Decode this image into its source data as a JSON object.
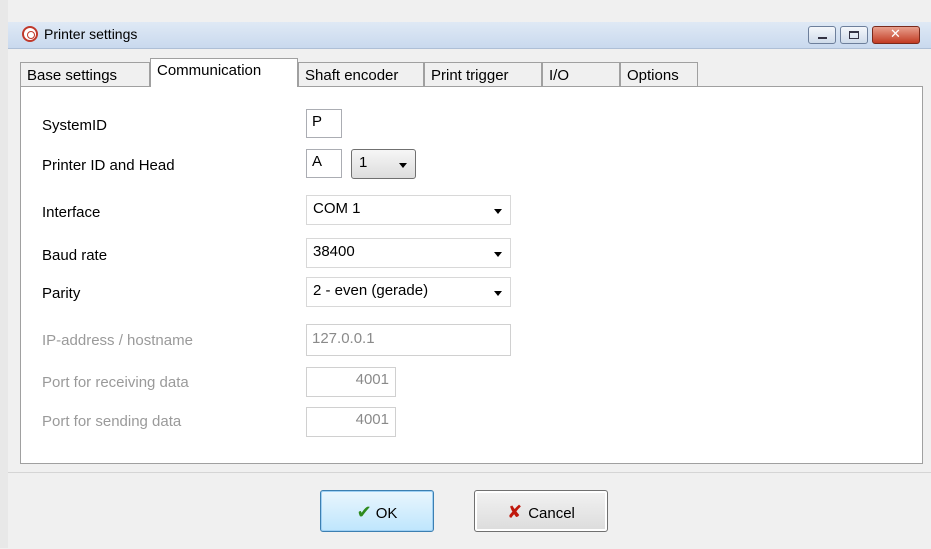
{
  "window": {
    "title": "Printer settings"
  },
  "tabs": [
    {
      "label": "Base settings",
      "active": false
    },
    {
      "label": "Communication",
      "active": true
    },
    {
      "label": "Shaft encoder",
      "active": false
    },
    {
      "label": "Print trigger",
      "active": false
    },
    {
      "label": "I/O",
      "active": false
    },
    {
      "label": "Options",
      "active": false
    }
  ],
  "form": {
    "system_id": {
      "label": "SystemID",
      "value": "P"
    },
    "printer_id": {
      "label": "Printer ID and Head",
      "value": "A",
      "head": "1"
    },
    "interface": {
      "label": "Interface",
      "value": "COM 1"
    },
    "baud_rate": {
      "label": "Baud rate",
      "value": "38400"
    },
    "parity": {
      "label": "Parity",
      "value": "2 - even (gerade)"
    },
    "ip_address": {
      "label": "IP-address / hostname",
      "value": "127.0.0.1"
    },
    "port_receive": {
      "label": "Port for receiving data",
      "value": "4001"
    },
    "port_send": {
      "label": "Port for sending data",
      "value": "4001"
    }
  },
  "buttons": {
    "ok": "OK",
    "cancel": "Cancel"
  },
  "icons": {
    "app": "printer-app-icon",
    "ok": "checkmark-icon",
    "cancel": "x-icon"
  }
}
